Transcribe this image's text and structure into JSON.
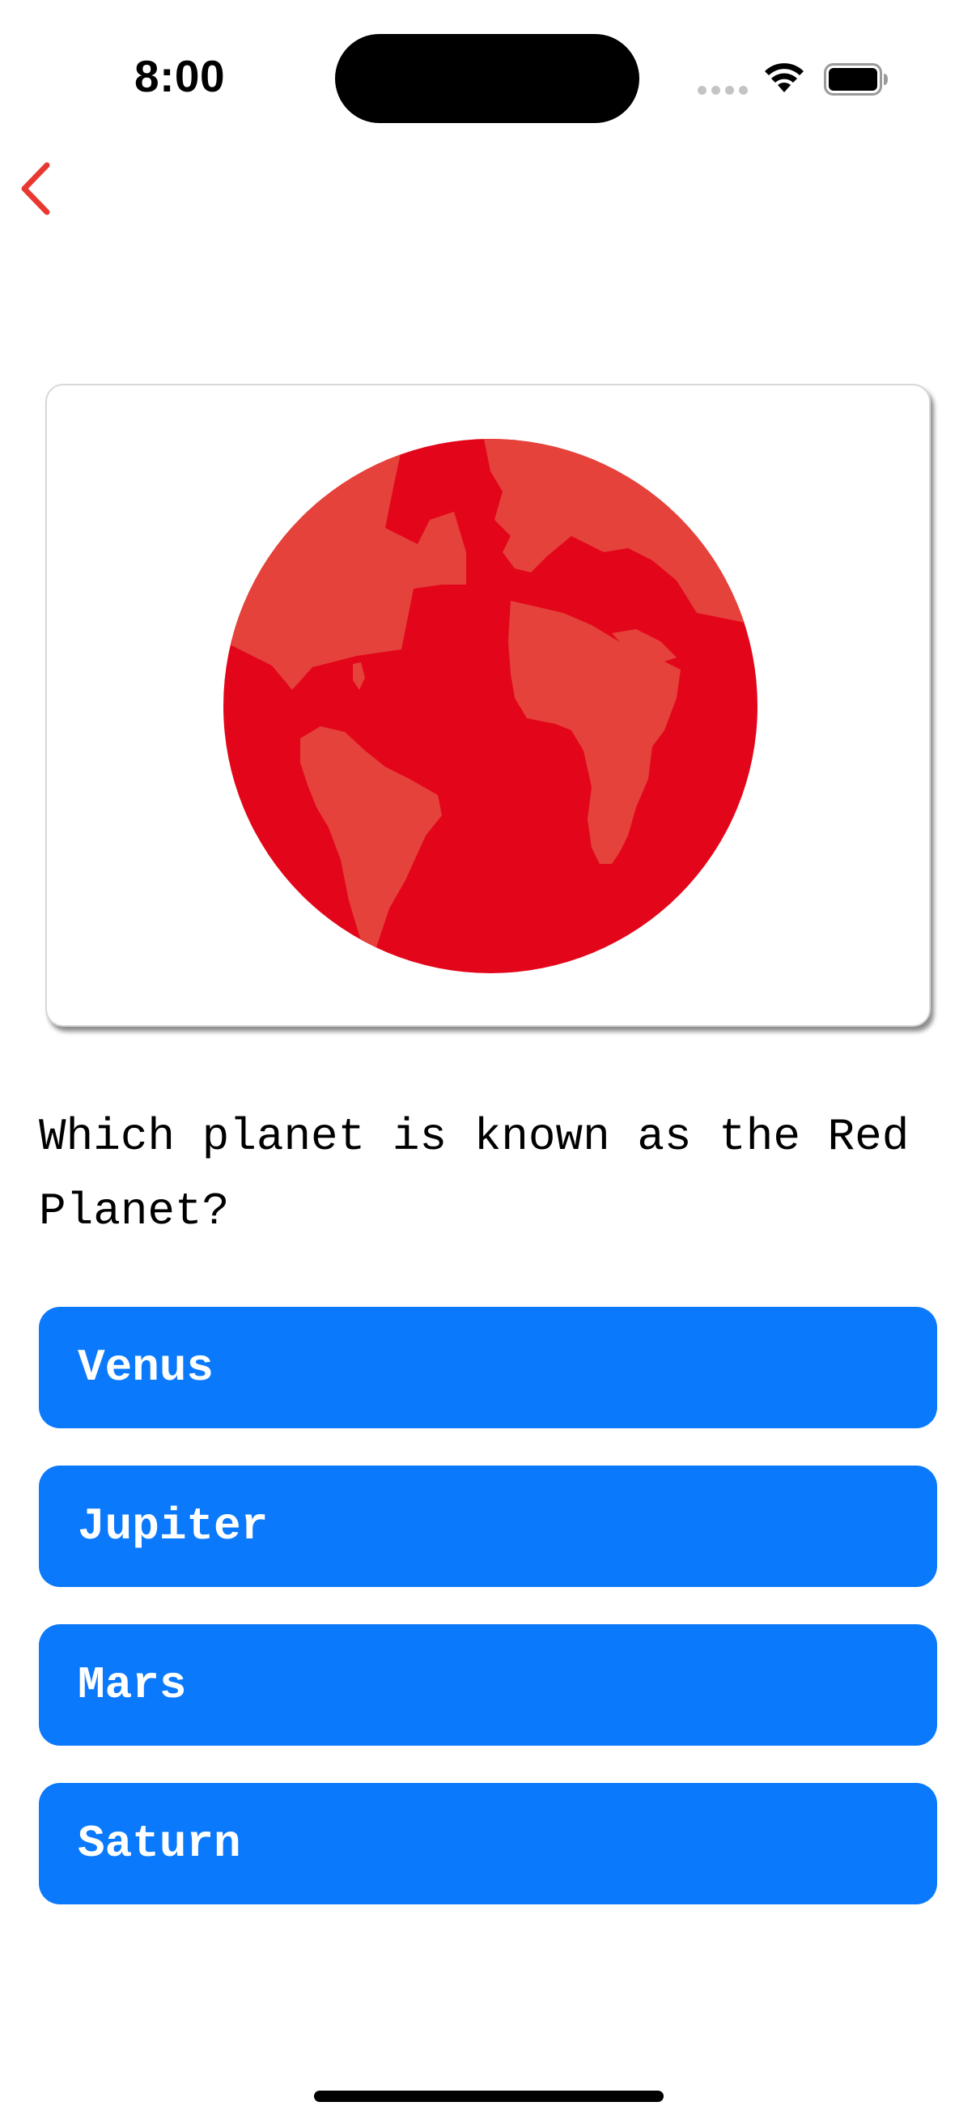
{
  "status_bar": {
    "time": "8:00",
    "icons": [
      "signal-icon",
      "wifi-icon",
      "battery-icon"
    ]
  },
  "navigation": {
    "back_icon": "chevron-left-icon",
    "accent_color": "#e8382f"
  },
  "card": {
    "image_icon": "globe-icon",
    "globe_color": "#e3061a",
    "land_color": "#e5423b"
  },
  "question": {
    "text": "Which planet is known as the Red Planet?"
  },
  "answers": [
    {
      "label": "Venus"
    },
    {
      "label": "Jupiter"
    },
    {
      "label": "Mars"
    },
    {
      "label": "Saturn"
    }
  ],
  "answer_button_color": "#0a79fb"
}
